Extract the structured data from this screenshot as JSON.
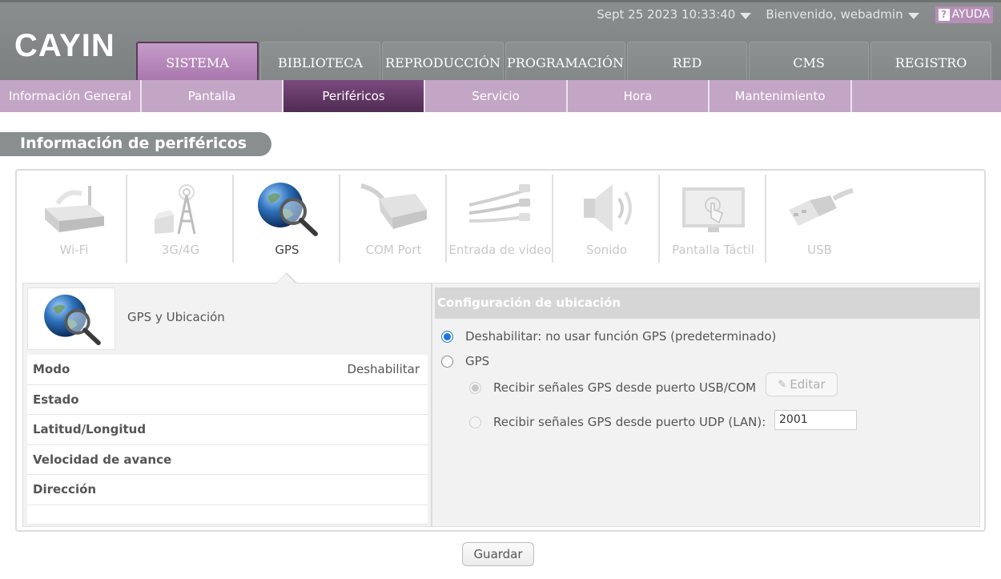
{
  "header": {
    "logo": "CAYIN",
    "datetime": "Sept 25 2023 10:33:40",
    "welcome": "Bienvenido, webadmin",
    "help": "AYUDA"
  },
  "main_tabs": [
    {
      "label": "SISTEMA",
      "active": true
    },
    {
      "label": "BIBLIOTECA"
    },
    {
      "label": "REPRODUCCIÓN"
    },
    {
      "label": "PROGRAMACIÓN"
    },
    {
      "label": "RED"
    },
    {
      "label": "CMS"
    },
    {
      "label": "REGISTRO"
    }
  ],
  "sub_tabs": [
    {
      "label": "Información General"
    },
    {
      "label": "Pantalla"
    },
    {
      "label": "Periféricos",
      "active": true
    },
    {
      "label": "Servicio"
    },
    {
      "label": "Hora"
    },
    {
      "label": "Mantenimiento"
    }
  ],
  "page_title": "Información de periféricos",
  "devices": [
    {
      "label": "Wi-Fi",
      "icon": "wifi-router-icon"
    },
    {
      "label": "3G/4G",
      "icon": "cell-tower-icon"
    },
    {
      "label": "GPS",
      "icon": "globe-magnifier-icon",
      "active": true
    },
    {
      "label": "COM Port",
      "icon": "serial-cable-icon"
    },
    {
      "label": "Entrada de video",
      "icon": "av-cable-icon"
    },
    {
      "label": "Sonido",
      "icon": "speaker-icon"
    },
    {
      "label": "Pantalla Táctil",
      "icon": "touch-screen-icon"
    },
    {
      "label": "USB",
      "icon": "usb-plug-icon"
    }
  ],
  "gps_panel": {
    "title": "GPS y Ubicación",
    "rows": [
      {
        "key": "Modo",
        "value": "Deshabilitar"
      },
      {
        "key": "Estado",
        "value": ""
      },
      {
        "key": "Latitud/Longitud",
        "value": ""
      },
      {
        "key": "Velocidad de avance",
        "value": ""
      },
      {
        "key": "Dirección",
        "value": ""
      }
    ]
  },
  "config": {
    "header": "Configuración de ubicación",
    "option_disable": "Deshabilitar: no usar función GPS (predeterminado)",
    "option_gps": "GPS",
    "sub_usb": "Recibir señales GPS desde puerto USB/COM",
    "edit_label": "Editar",
    "sub_udp": "Recibir señales GPS desde puerto UDP (LAN):",
    "udp_port": "2001"
  },
  "save_label": "Guardar",
  "colors": {
    "accent": "#a775ab",
    "subnav": "#c3a5c6",
    "active_sub": "#5e3561",
    "radio": "#1a73e8"
  }
}
